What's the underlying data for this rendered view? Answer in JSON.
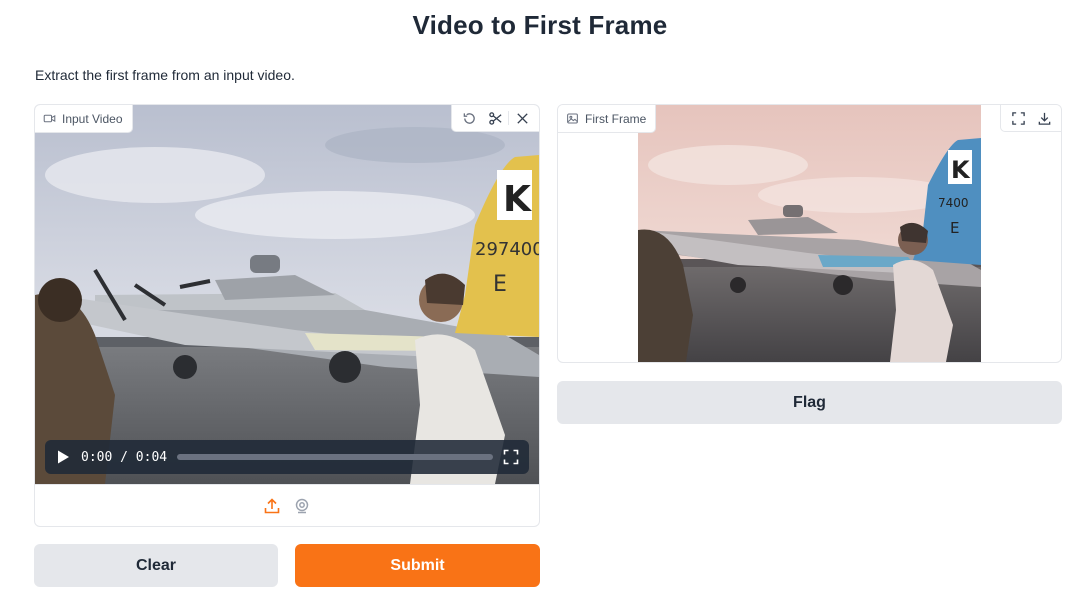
{
  "page": {
    "title": "Video to First Frame",
    "description": "Extract the first frame from an input video."
  },
  "input_panel": {
    "label": "Input Video",
    "label_icon": "video-camera-icon",
    "tools": [
      "undo-icon",
      "scissors-icon",
      "close-icon"
    ],
    "player": {
      "play_icon": "play-icon",
      "time_text": "0:00 / 0:04",
      "progress": 0,
      "fullscreen_icon": "fullscreen-icon"
    },
    "sources": [
      "upload-icon",
      "webcam-icon"
    ]
  },
  "output_panel": {
    "label": "First Frame",
    "label_icon": "image-icon",
    "tools": [
      "fullscreen-icon",
      "download-icon"
    ]
  },
  "buttons": {
    "clear": "Clear",
    "submit": "Submit",
    "flag": "Flag"
  },
  "colors": {
    "accent": "#f97316",
    "secondary_button": "#e5e7eb",
    "text": "#1f2937"
  }
}
